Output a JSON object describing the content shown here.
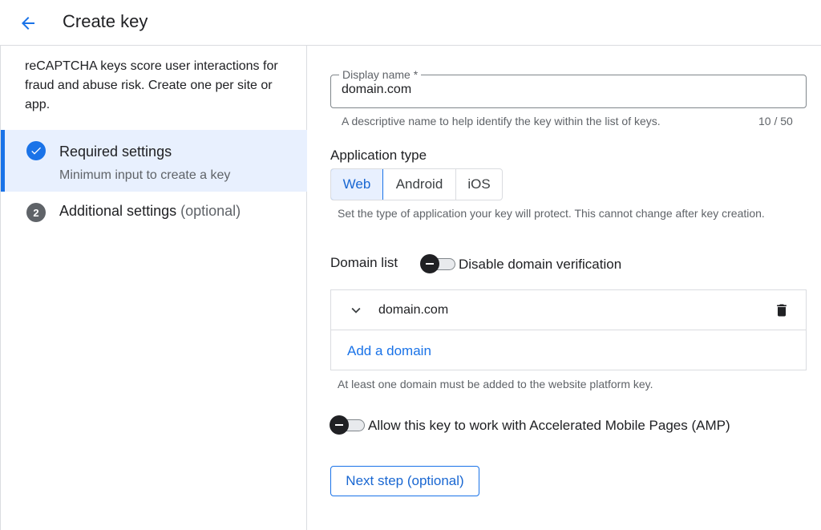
{
  "header": {
    "title": "Create key",
    "back_icon": "arrow-back-icon"
  },
  "sidebar": {
    "description": "reCAPTCHA keys score user interactions for fraud and abuse risk. Create one per site or app.",
    "steps": [
      {
        "title": "Required settings",
        "subtitle": "Minimum input to create a key",
        "icon": "check-circle-icon"
      },
      {
        "number": "2",
        "title": "Additional settings",
        "optional": "(optional)"
      }
    ]
  },
  "display_name": {
    "label": "Display name *",
    "value": "domain.com",
    "hint": "A descriptive name to help identify the key within the list of keys.",
    "counter": "10 / 50"
  },
  "application_type": {
    "title": "Application type",
    "options": [
      "Web",
      "Android",
      "iOS"
    ],
    "selected": "Web",
    "hint": "Set the type of application your key will protect. This cannot change after key creation."
  },
  "domain_list": {
    "title": "Domain list",
    "toggle_label": "Disable domain verification",
    "domains": [
      "domain.com"
    ],
    "add_label": "Add a domain",
    "hint": "At least one domain must be added to the website platform key."
  },
  "amp": {
    "toggle_label": "Allow this key to work with Accelerated Mobile Pages (AMP)"
  },
  "next_button": {
    "label": "Next step (optional)"
  },
  "colors": {
    "accent": "#1a73e8",
    "selected_bg": "#e8f0fe",
    "text": "#202124",
    "muted": "#5f6368",
    "border": "#dadce0"
  }
}
